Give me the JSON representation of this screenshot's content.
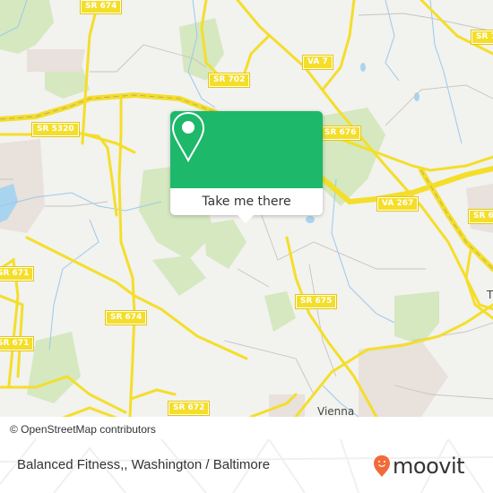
{
  "map": {
    "road_labels": [
      {
        "id": "sr674-top",
        "text": "SR 674"
      },
      {
        "id": "sr702",
        "text": "SR 702"
      },
      {
        "id": "sr5320",
        "text": "SR 5320"
      },
      {
        "id": "va7",
        "text": "VA 7"
      },
      {
        "id": "sr676",
        "text": "SR 676"
      },
      {
        "id": "sr-top-right",
        "text": "SR 7"
      },
      {
        "id": "va267",
        "text": "VA 267"
      },
      {
        "id": "sr6-right",
        "text": "SR 6"
      },
      {
        "id": "sr671-upper",
        "text": "SR 671"
      },
      {
        "id": "sr671-lower",
        "text": "SR 671"
      },
      {
        "id": "sr674-mid",
        "text": "SR 674"
      },
      {
        "id": "sr675",
        "text": "SR 675"
      },
      {
        "id": "sr672",
        "text": "SR 672"
      }
    ],
    "place_labels": [
      {
        "id": "vienna",
        "text": "Vienna"
      },
      {
        "id": "t-partial",
        "text": "T"
      }
    ],
    "colors": {
      "background": "#f2f2ef",
      "road": "#f4de2a",
      "park": "#d5e8c0",
      "water": "#a8d4f0",
      "urban": "#e8e1dc"
    }
  },
  "attribution": "© OpenStreetMap contributors",
  "popup": {
    "button_label": "Take me there",
    "icon": "map-pin-icon",
    "color": "#1db86a"
  },
  "footer": {
    "title": "Balanced Fitness,, Washington / Baltimore",
    "brand": "moovit",
    "brand_color": "#f26a3a"
  }
}
